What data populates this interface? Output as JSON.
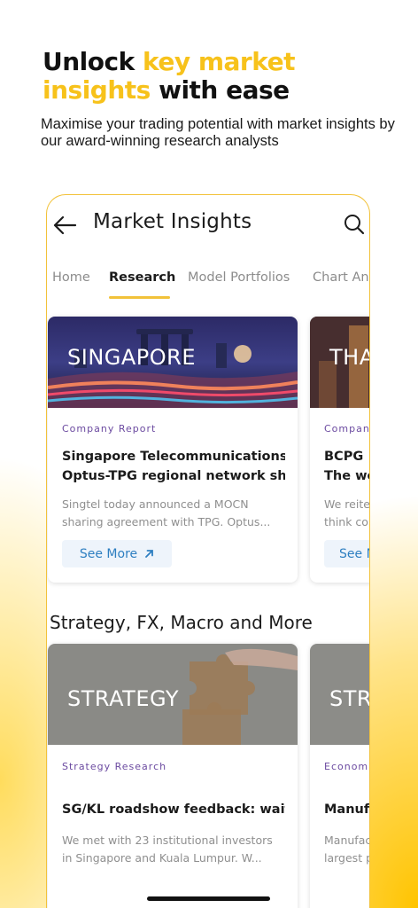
{
  "promo": {
    "headline_part1": "Unlock ",
    "headline_highlight1": "key market insights",
    "headline_part2": " with ease",
    "subtitle": "Maximise your trading potential with market insights by our award-winning research analysts"
  },
  "colors": {
    "accent": "#f7c21b",
    "link": "#2e7fc1",
    "category": "#6b4aa0"
  },
  "app": {
    "title": "Market Insights",
    "back_icon": "back-arrow-icon",
    "search_icon": "search-icon",
    "tabs": [
      {
        "label": "Home",
        "active": false
      },
      {
        "label": "Research",
        "active": true
      },
      {
        "label": "Model Portfolios",
        "active": false
      },
      {
        "label": "Chart An",
        "active": false
      }
    ]
  },
  "research_cards": [
    {
      "image_text": "SINGAPORE",
      "category": "Company Report",
      "title_line1": "Singapore Telecommunications",
      "title_line2": "Optus-TPG regional network sh...",
      "body_line1": "Singtel today announced a MOCN",
      "body_line2": "sharing agreement with TPG. Optus...",
      "button": "See More"
    },
    {
      "image_text": "THA",
      "category": "Compan",
      "title_line1": "BCPG",
      "title_line2": "The wo",
      "body_line1": "We reite",
      "body_line2": "think co",
      "button": "See M"
    }
  ],
  "section2": {
    "title": "Strategy, FX, Macro and More",
    "cards": [
      {
        "image_text": "STRATEGY",
        "category": "Strategy Research",
        "title_line1": "SG/KL roadshow feedback: wait...",
        "body_line1": "We met with 23 institutional investors",
        "body_line2": "in Singapore and Kuala Lumpur.   W..."
      },
      {
        "image_text": "STRA",
        "category": "Econom",
        "title_line1": "Manufa",
        "body_line1": "Manufac",
        "body_line2": "largest p"
      }
    ]
  }
}
